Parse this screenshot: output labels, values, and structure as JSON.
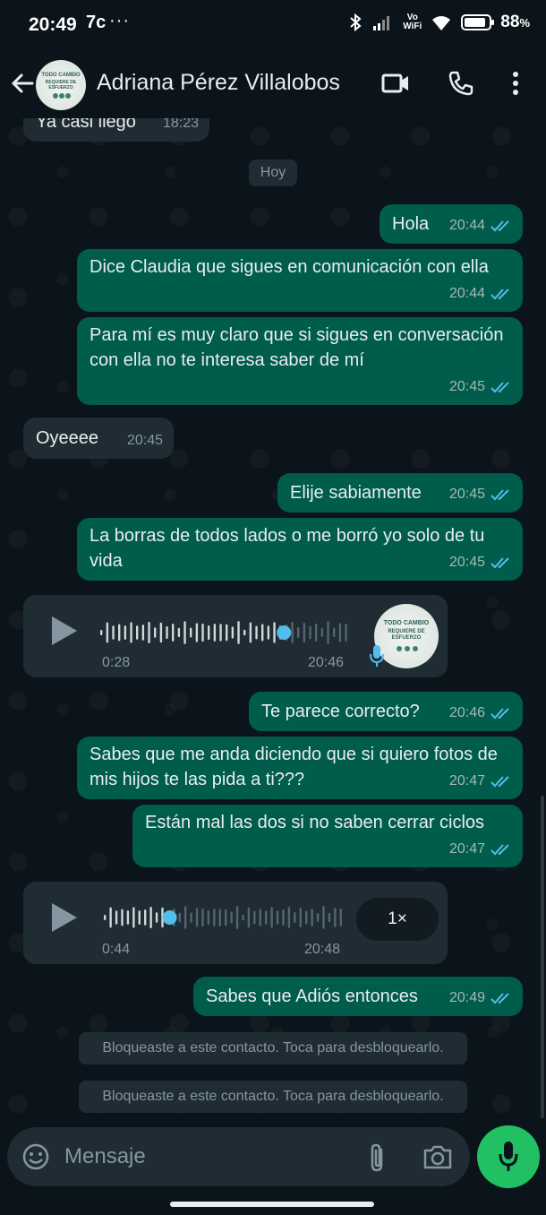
{
  "status_bar": {
    "time": "20:49",
    "extra": "7c",
    "dots": "···",
    "vowifi_top": "Vo",
    "vowifi_bottom": "WiFi",
    "battery_text": "88",
    "battery_unit": "%",
    "battery_level": 0.88
  },
  "header": {
    "contact_name": "Adriana Pérez Villalobos",
    "avatar_text_1": "TODO CAMBIO",
    "avatar_text_2": "REQUIERE DE",
    "avatar_text_3": "ESFUERZO",
    "icons": [
      "back-arrow-icon",
      "video-call-icon",
      "phone-icon",
      "more-vert-icon"
    ]
  },
  "chat": {
    "partial_top": {
      "text": "Ya casi llego",
      "time": "18:23"
    },
    "day_label": "Hoy",
    "messages": [
      {
        "dir": "out",
        "text": "Hola",
        "time": "20:44"
      },
      {
        "dir": "out",
        "text": "Dice Claudia que sigues en comunicación con ella",
        "time": "20:44"
      },
      {
        "dir": "out",
        "text": "Para mí es muy claro que si sigues en conversación con ella no te interesa saber de mí",
        "time": "20:45"
      },
      {
        "dir": "in",
        "text": "Oyeeee",
        "time": "20:45"
      },
      {
        "dir": "out",
        "text": "Elije sabiamente",
        "time": "20:45"
      },
      {
        "dir": "out",
        "text": "La borras de todos lados o me borró yo solo de tu vida",
        "time": "20:45"
      },
      {
        "dir": "in",
        "type": "voice",
        "duration": "0:28",
        "time": "20:46",
        "progress": 0.74
      },
      {
        "dir": "out",
        "text": "Te parece correcto?",
        "time": "20:46"
      },
      {
        "dir": "out",
        "text": "Sabes que me anda diciendo que si quiero fotos de mis hijos te las pida a ti???",
        "time": "20:47"
      },
      {
        "dir": "out",
        "text": "Están mal las dos si no saben cerrar ciclos",
        "time": "20:47"
      },
      {
        "dir": "in",
        "type": "voice",
        "duration": "0:44",
        "time": "20:48",
        "progress": 0.28,
        "speed": "1×"
      },
      {
        "dir": "out",
        "text": "Sabes que Adiós entonces",
        "time": "20:49"
      }
    ],
    "system_messages": [
      "Bloqueaste a este contacto. Toca para desbloquearlo.",
      "Bloqueaste a este contacto. Toca para desbloquearlo."
    ],
    "colors": {
      "incoming": "#1f2c34",
      "outgoing": "#005c4b",
      "read_ticks": "#53bdeb",
      "voice_dot": "#53bdeb",
      "mic_button": "#21c063"
    }
  },
  "composer": {
    "placeholder": "Mensaje",
    "value": "",
    "icons": [
      "emoji-icon",
      "attach-icon",
      "camera-icon",
      "mic-icon"
    ]
  }
}
